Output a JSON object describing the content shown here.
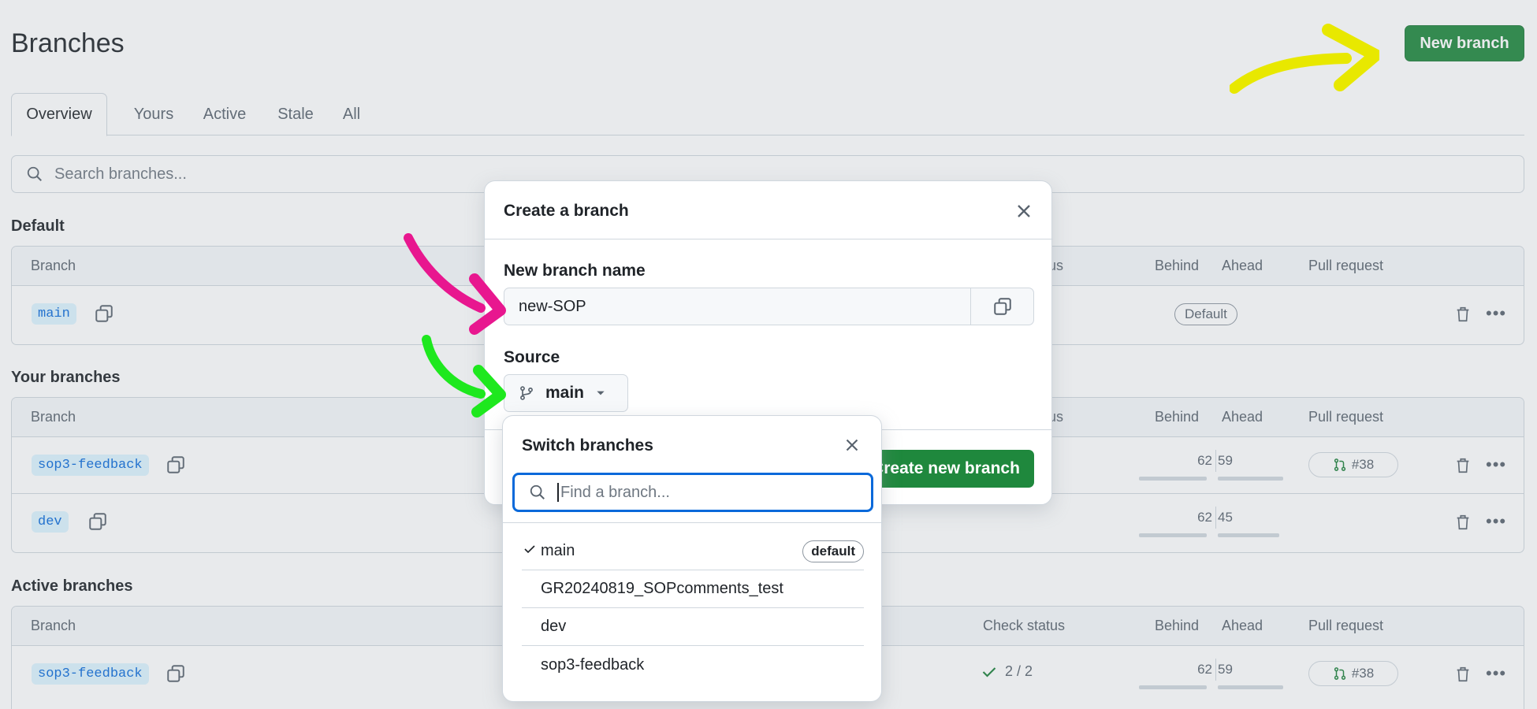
{
  "header": {
    "title": "Branches",
    "new_branch_label": "New branch"
  },
  "tabs": [
    "Overview",
    "Yours",
    "Active",
    "Stale",
    "All"
  ],
  "search": {
    "placeholder": "Search branches..."
  },
  "sections": {
    "default": "Default",
    "yours": "Your branches",
    "active": "Active branches"
  },
  "table_headers": {
    "branch": "Branch",
    "check_status": "Check status",
    "check_status_partial": "us",
    "behind": "Behind",
    "ahead": "Ahead",
    "pull_request": "Pull request"
  },
  "default_rows": [
    {
      "name": "main",
      "badge": "Default"
    }
  ],
  "your_rows": [
    {
      "name": "sop3-feedback",
      "behind": "62",
      "ahead": "59",
      "pr": "#38"
    },
    {
      "name": "dev",
      "behind": "62",
      "ahead": "45"
    }
  ],
  "active_rows": [
    {
      "name": "sop3-feedback",
      "check": "2 / 2",
      "behind": "62",
      "ahead": "59",
      "pr": "#38"
    }
  ],
  "dialog": {
    "title": "Create a branch",
    "name_label": "New branch name",
    "name_value": "new-SOP",
    "source_label": "Source",
    "source_value": "main",
    "create_label": "Create new branch"
  },
  "switcher": {
    "title": "Switch branches",
    "placeholder": "Find a branch...",
    "items": [
      {
        "name": "main",
        "selected": true,
        "badge": "default"
      },
      {
        "name": "GR20240819_SOPcomments_test"
      },
      {
        "name": "dev"
      },
      {
        "name": "sop3-feedback"
      }
    ]
  },
  "colors": {
    "primary_green": "#1f883d",
    "accent_blue": "#0969da",
    "annotation_yellow": "#e8e800",
    "annotation_magenta": "#e8178f",
    "annotation_green": "#1ee81e"
  }
}
